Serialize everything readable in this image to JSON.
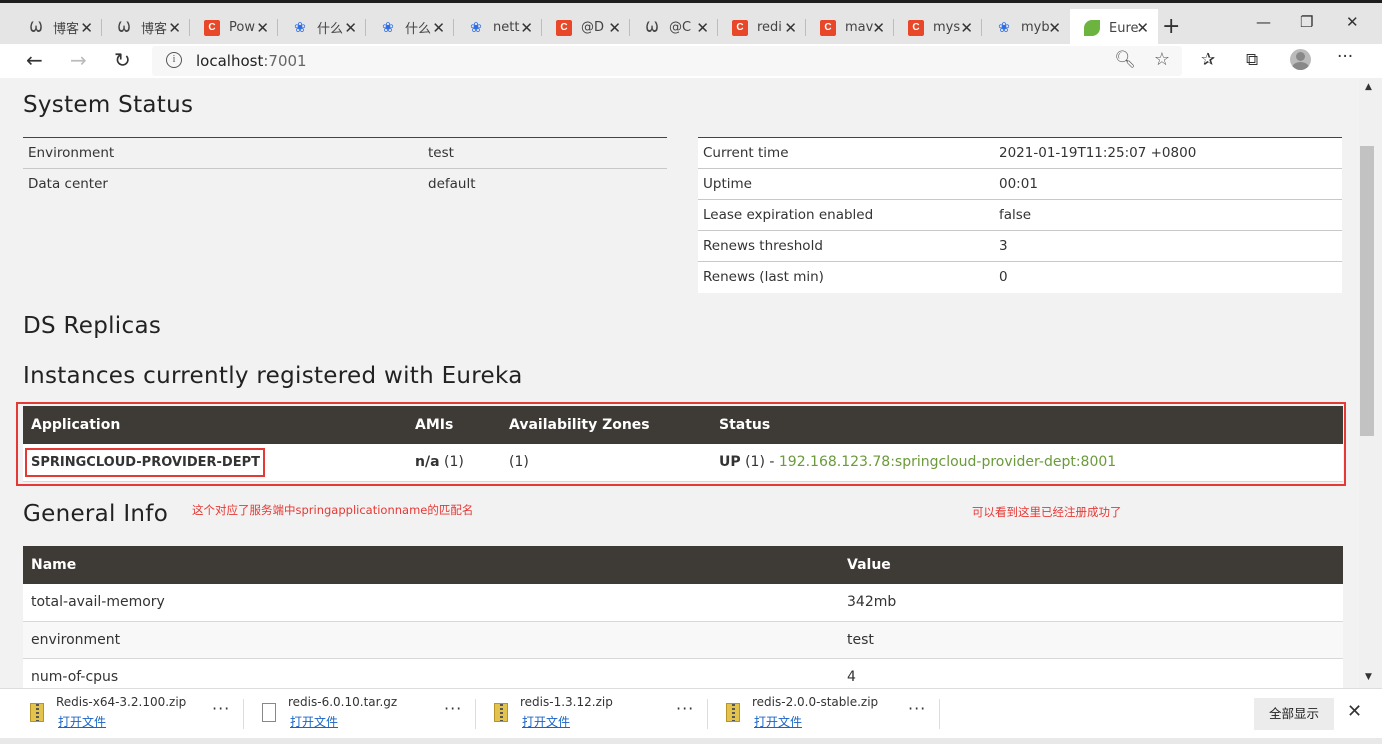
{
  "browser": {
    "tabs": [
      {
        "label": "博客",
        "icon": "w"
      },
      {
        "label": "博客",
        "icon": "w"
      },
      {
        "label": "Pow",
        "icon": "c"
      },
      {
        "label": "什么",
        "icon": "paw"
      },
      {
        "label": "什么",
        "icon": "paw"
      },
      {
        "label": "nett",
        "icon": "paw"
      },
      {
        "label": "@D",
        "icon": "c"
      },
      {
        "label": "@C",
        "icon": "w"
      },
      {
        "label": "redi",
        "icon": "c"
      },
      {
        "label": "mav",
        "icon": "c"
      },
      {
        "label": "mys",
        "icon": "c"
      },
      {
        "label": "myb",
        "icon": "paw"
      },
      {
        "label": "Eure",
        "icon": "spring"
      }
    ],
    "url_host": "localhost",
    "url_port": ":7001"
  },
  "system_status": {
    "title": "System Status",
    "left": [
      {
        "key": "Environment",
        "value": "test"
      },
      {
        "key": "Data center",
        "value": "default"
      }
    ],
    "right": [
      {
        "key": "Current time",
        "value": "2021-01-19T11:25:07 +0800"
      },
      {
        "key": "Uptime",
        "value": "00:01"
      },
      {
        "key": "Lease expiration enabled",
        "value": "false"
      },
      {
        "key": "Renews threshold",
        "value": "3"
      },
      {
        "key": "Renews (last min)",
        "value": "0"
      }
    ]
  },
  "ds_replicas": {
    "title": "DS Replicas"
  },
  "instances": {
    "title": "Instances currently registered with Eureka",
    "headers": [
      "Application",
      "AMIs",
      "Availability Zones",
      "Status"
    ],
    "row": {
      "application": "SPRINGCLOUD-PROVIDER-DEPT",
      "amis_bold": "n/a",
      "amis_count": " (1)",
      "zones": "(1)",
      "status_bold": "UP",
      "status_count": " (1) - ",
      "status_link": "192.168.123.78:springcloud-provider-dept:8001"
    }
  },
  "annotations": {
    "left": "这个对应了服务端中springapplicationname的匹配名",
    "right": "可以看到这里已经注册成功了"
  },
  "general_info": {
    "title": "General Info",
    "headers": [
      "Name",
      "Value"
    ],
    "rows": [
      {
        "name": "total-avail-memory",
        "value": "342mb"
      },
      {
        "name": "environment",
        "value": "test"
      },
      {
        "name": "num-of-cpus",
        "value": "4"
      }
    ]
  },
  "downloads": {
    "items": [
      {
        "name": "Redis-x64-3.2.100.zip",
        "action": "打开文件",
        "type": "zip"
      },
      {
        "name": "redis-6.0.10.tar.gz",
        "action": "打开文件",
        "type": "doc"
      },
      {
        "name": "redis-1.3.12.zip",
        "action": "打开文件",
        "type": "zip"
      },
      {
        "name": "redis-2.0.0-stable.zip",
        "action": "打开文件",
        "type": "zip"
      }
    ],
    "show_all": "全部显示"
  }
}
